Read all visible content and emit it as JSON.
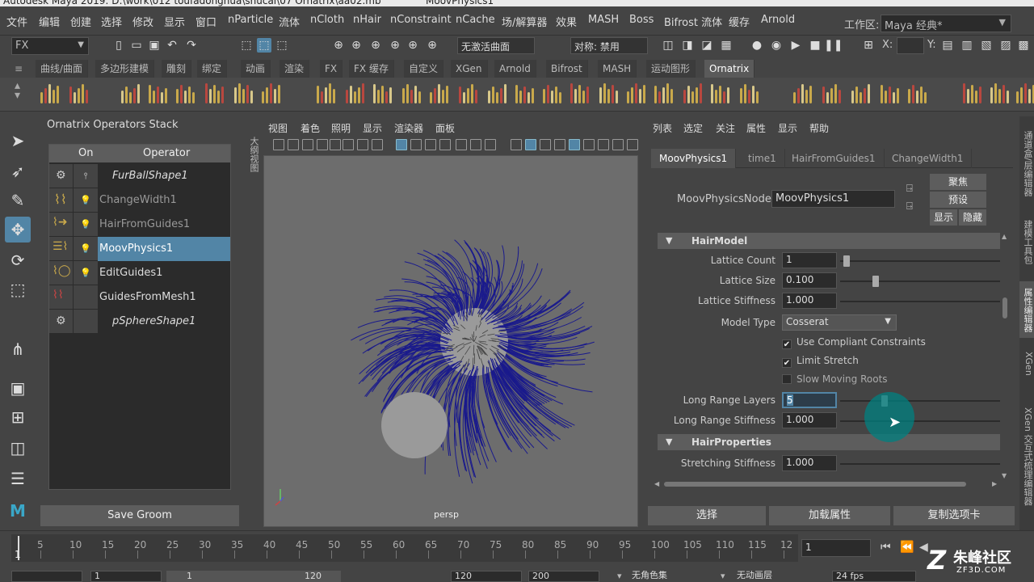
{
  "title_bar": {
    "left_text": "Autodesk Maya 2019: D:\\work\\012 toufadonghua\\shucai\\07 Ornatrix\\aa02.mb",
    "right_text": "MoovPhysics1"
  },
  "menubar": {
    "items": [
      "文件",
      "编辑",
      "创建",
      "选择",
      "修改",
      "显示",
      "窗口",
      "nParticle",
      "流体",
      "nCloth",
      "nHair",
      "nConstraint",
      "nCache",
      "场/解算器",
      "效果",
      "MASH",
      "Boss",
      "Bifrost 流体",
      "缓存",
      "Arnold"
    ],
    "workspace_label": "工作区:",
    "workspace_value": "Maya 经典*"
  },
  "status_line": {
    "menu_set": "FX",
    "live_surface": "无激活曲面",
    "symmetry": "对称: 禁用",
    "x_label": "X:",
    "y_label": "Y:"
  },
  "shelf": {
    "tabs": [
      "曲线/曲面",
      "多边形建模",
      "雕刻",
      "绑定",
      "动画",
      "渲染",
      "FX",
      "FX 缓存",
      "自定义",
      "XGen",
      "Arnold",
      "Bifrost",
      "MASH",
      "运动图形",
      "Ornatrix"
    ],
    "active_tab": "Ornatrix"
  },
  "operators_panel": {
    "title": "Ornatrix Operators Stack",
    "col_on": "On",
    "col_operator": "Operator",
    "rows": [
      {
        "name": "FurBallShape1"
      },
      {
        "name": "ChangeWidth1"
      },
      {
        "name": "HairFromGuides1"
      },
      {
        "name": "MoovPhysics1"
      },
      {
        "name": "EditGuides1"
      },
      {
        "name": "GuidesFromMesh1"
      },
      {
        "name": "pSphereShape1"
      }
    ],
    "selected": "MoovPhysics1",
    "save_button": "Save Groom"
  },
  "viewport": {
    "side_tab": "大纲视图",
    "menu": [
      "视图",
      "着色",
      "照明",
      "显示",
      "渲染器",
      "面板"
    ],
    "camera_label": "persp",
    "hair_color": "#1a1a8c",
    "sphere_color": "#9a9a9a"
  },
  "attribute_editor": {
    "menu": [
      "列表",
      "选定",
      "关注",
      "属性",
      "显示",
      "帮助"
    ],
    "tabs": [
      "MoovPhysics1",
      "time1",
      "HairFromGuides1",
      "ChangeWidth1"
    ],
    "active_tab": "MoovPhysics1",
    "node_label": "MoovPhysicsNode:",
    "node_value": "MoovPhysics1",
    "focus_button": "聚焦",
    "preset_button": "预设",
    "show_button": "显示",
    "hide_button": "隐藏",
    "sections": {
      "hair_model": "HairModel",
      "hair_properties": "HairProperties"
    },
    "attrs": {
      "lattice_count": {
        "label": "Lattice Count",
        "value": "1",
        "slider": 0.02
      },
      "lattice_size": {
        "label": "Lattice Size",
        "value": "0.100",
        "slider": 0.21
      },
      "lattice_stiffness": {
        "label": "Lattice Stiffness",
        "value": "1.000",
        "slider": 1.0
      },
      "model_type": {
        "label": "Model Type",
        "value": "Cosserat"
      },
      "use_compliant": {
        "label": "Use Compliant Constraints",
        "checked": true
      },
      "limit_stretch": {
        "label": "Limit Stretch",
        "checked": true
      },
      "slow_roots": {
        "label": "Slow Moving Roots",
        "checked": false
      },
      "long_range_layers": {
        "label": "Long Range Layers",
        "value": "5",
        "slider": 0.27
      },
      "long_range_stiffness": {
        "label": "Long Range Stiffness",
        "value": "1.000",
        "slider": 1.0
      },
      "stretching_stiffness": {
        "label": "Stretching Stiffness",
        "value": "1.000",
        "slider": 1.0
      }
    },
    "bottom_buttons": [
      "选择",
      "加载属性",
      "复制选项卡"
    ]
  },
  "right_tabs": [
    "通道盒/层编辑器",
    "建模工具包",
    "属性编辑器",
    "XGen",
    "XGen 交互式梳理编辑器"
  ],
  "timeline": {
    "ticks": [
      "5",
      "10",
      "15",
      "20",
      "25",
      "30",
      "35",
      "40",
      "45",
      "50",
      "55",
      "60",
      "65",
      "70",
      "75",
      "80",
      "85",
      "90",
      "95",
      "100",
      "105",
      "110",
      "115",
      "12"
    ],
    "current_frame": "1",
    "frame_field": "1"
  },
  "range": {
    "start": "1",
    "inner_start": "1",
    "inner_end": "120",
    "end": "120",
    "max": "200",
    "char_set": "无角色集",
    "anim_layer": "无动画层",
    "fps": "24 fps"
  },
  "watermark": {
    "text": "朱峰社区",
    "url": "ZF3D.COM"
  },
  "colors": {
    "accent": "#5285a6",
    "panel": "#444444",
    "field": "#2b2b2b",
    "cursor_ring": "#008080"
  }
}
